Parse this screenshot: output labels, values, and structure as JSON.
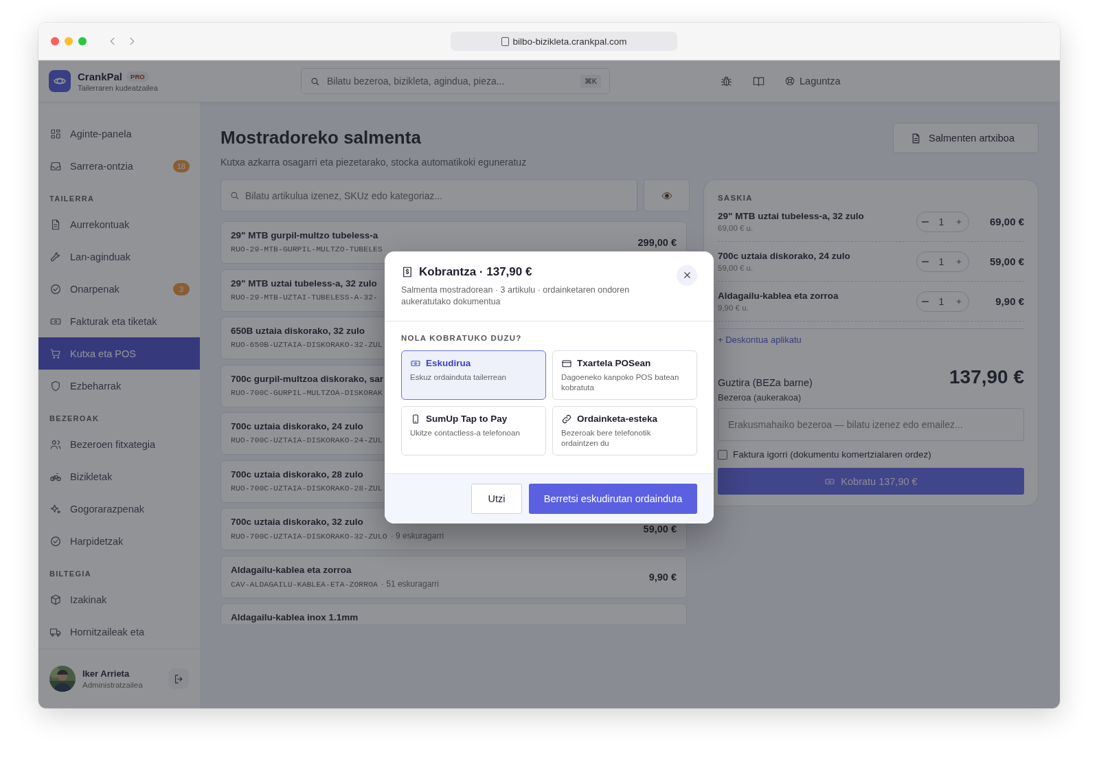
{
  "browser": {
    "url": "bilbo-bizikleta.crankpal.com"
  },
  "brand": {
    "name": "CrankPal",
    "badge": "PRO",
    "subtitle": "Tailerraren kudeatzailea"
  },
  "search": {
    "placeholder": "Bilatu bezeroa, bizikleta, agindua, pieza...",
    "shortcut": "⌘K"
  },
  "topbar": {
    "help": "Laguntza"
  },
  "sidebar": {
    "sections": [
      {
        "items": [
          {
            "label": "Aginte-panela",
            "selected": false
          },
          {
            "label": "Sarrera-ontzia",
            "badge": "18",
            "selected": false
          }
        ]
      },
      {
        "title": "TAILERRA",
        "items": [
          {
            "label": "Aurrekontuak",
            "selected": false
          },
          {
            "label": "Lan-aginduak",
            "selected": false
          },
          {
            "label": "Onarpenak",
            "badge": "3",
            "selected": false
          },
          {
            "label": "Fakturak eta tiketak",
            "selected": false
          },
          {
            "label": "Kutxa eta POS",
            "selected": true
          },
          {
            "label": "Ezbeharrak",
            "selected": false
          }
        ]
      },
      {
        "title": "BEZEROAK",
        "items": [
          {
            "label": "Bezeroen fitxategia",
            "selected": false
          },
          {
            "label": "Bizikletak",
            "selected": false
          },
          {
            "label": "Gogorarazpenak",
            "selected": false
          },
          {
            "label": "Harpidetzak",
            "selected": false
          }
        ]
      },
      {
        "title": "BILTEGIA",
        "items": [
          {
            "label": "Izakinak",
            "selected": false
          },
          {
            "label": "Hornitzaileak eta",
            "selected": false
          }
        ]
      }
    ]
  },
  "user": {
    "name": "Iker Arrieta",
    "role": "Administratzailea"
  },
  "page": {
    "title": "Mostradoreko salmenta",
    "subtitle": "Kutxa azkarra osagarri eta piezetarako, stocka automatikoki eguneratuz",
    "archive_button": "Salmenten artxiboa"
  },
  "product_search": {
    "placeholder": "Bilatu artikulua izenez, SKUz edo kategoriaz..."
  },
  "products": [
    {
      "name": "29\" MTB gurpil-multzo tubeless-a",
      "sku": "RUO-29-MTB-GURPIL-MULTZO-TUBELES",
      "price": "299,00 €"
    },
    {
      "name": "29\" MTB uztai tubeless-a, 32 zulo",
      "sku": "RUO-29-MTB-UZTAI-TUBELESS-A-32-"
    },
    {
      "name": "650B uztaia diskorako, 32 zulo",
      "sku": "RUO-650B-UZTAIA-DISKORAKO-32-ZUL"
    },
    {
      "name": "700c gurpil-multzoa diskorako, sar",
      "sku": "RUO-700C-GURPIL-MULTZOA-DISKORAK"
    },
    {
      "name": "700c uztaia diskorako, 24 zulo",
      "sku": "RUO-700C-UZTAIA-DISKORAKO-24-ZUL"
    },
    {
      "name": "700c uztaia diskorako, 28 zulo",
      "sku": "RUO-700C-UZTAIA-DISKORAKO-28-ZUL"
    },
    {
      "name": "700c uztaia diskorako, 32 zulo",
      "sku": "RUO-700C-UZTAIA-DISKORAKO-32-ZULO",
      "stock": "· 9 eskuragarri",
      "price": "59,00 €"
    },
    {
      "name": "Aldagailu-kablea eta zorroa",
      "sku": "CAV-ALDAGAILU-KABLEA-ETA-ZORROA",
      "stock": "· 51 eskuragarri",
      "price": "9,90 €"
    },
    {
      "name": "Aldagailu-kablea inox 1.1mm"
    }
  ],
  "cart": {
    "title": "SASKIA",
    "items": [
      {
        "name": "29\" MTB uztai tubeless-a, 32 zulo",
        "unit_price": "69,00 € u.",
        "quantity": "1",
        "total": "69,00 €"
      },
      {
        "name": "700c uztaia diskorako, 24 zulo",
        "unit_price": "59,00 € u.",
        "quantity": "1",
        "total": "59,00 €"
      },
      {
        "name": "Aldagailu-kablea eta zorroa",
        "unit_price": "9,90 € u.",
        "quantity": "1",
        "total": "9,90 €"
      }
    ],
    "discount_link": "+ Deskontua aplikatu",
    "total_label": "Guztira (BEZa barne)",
    "total": "137,90 €",
    "customer_label": "Bezeroa (aukerakoa)",
    "customer_placeholder": "Erakusmahaiko bezeroa — bilatu izenez edo emailez...",
    "invoice": {
      "label": "Faktura igorri (dokumentu komertzialaren ordez)",
      "checked": false
    },
    "charge_button": "Kobratu 137,90 €"
  },
  "modal": {
    "title": "Kobrantza · 137,90 €",
    "subtitle": "Salmenta mostradorean · 3 artikulu · ordainketaren ondoren aukeratutako dokumentua",
    "section_label": "NOLA KOBRATUKO DUZU?",
    "methods": [
      {
        "kind": "cash",
        "title": "Eskudirua",
        "description": "Eskuz ordainduta tailerrean",
        "selected": true
      },
      {
        "kind": "card",
        "title": "Txartela POSean",
        "description": "Dagoeneko kanpoko POS batean kobratuta",
        "selected": false
      },
      {
        "kind": "phone",
        "title": "SumUp Tap to Pay",
        "description": "Ukitze contactless-a telefonoan",
        "selected": false
      },
      {
        "kind": "link",
        "title": "Ordainketa-esteka",
        "description": "Bezeroak bere telefonotik ordaintzen du",
        "selected": false
      }
    ],
    "cancel": "Utzi",
    "confirm": "Berretsi eskudirutan ordainduta"
  }
}
